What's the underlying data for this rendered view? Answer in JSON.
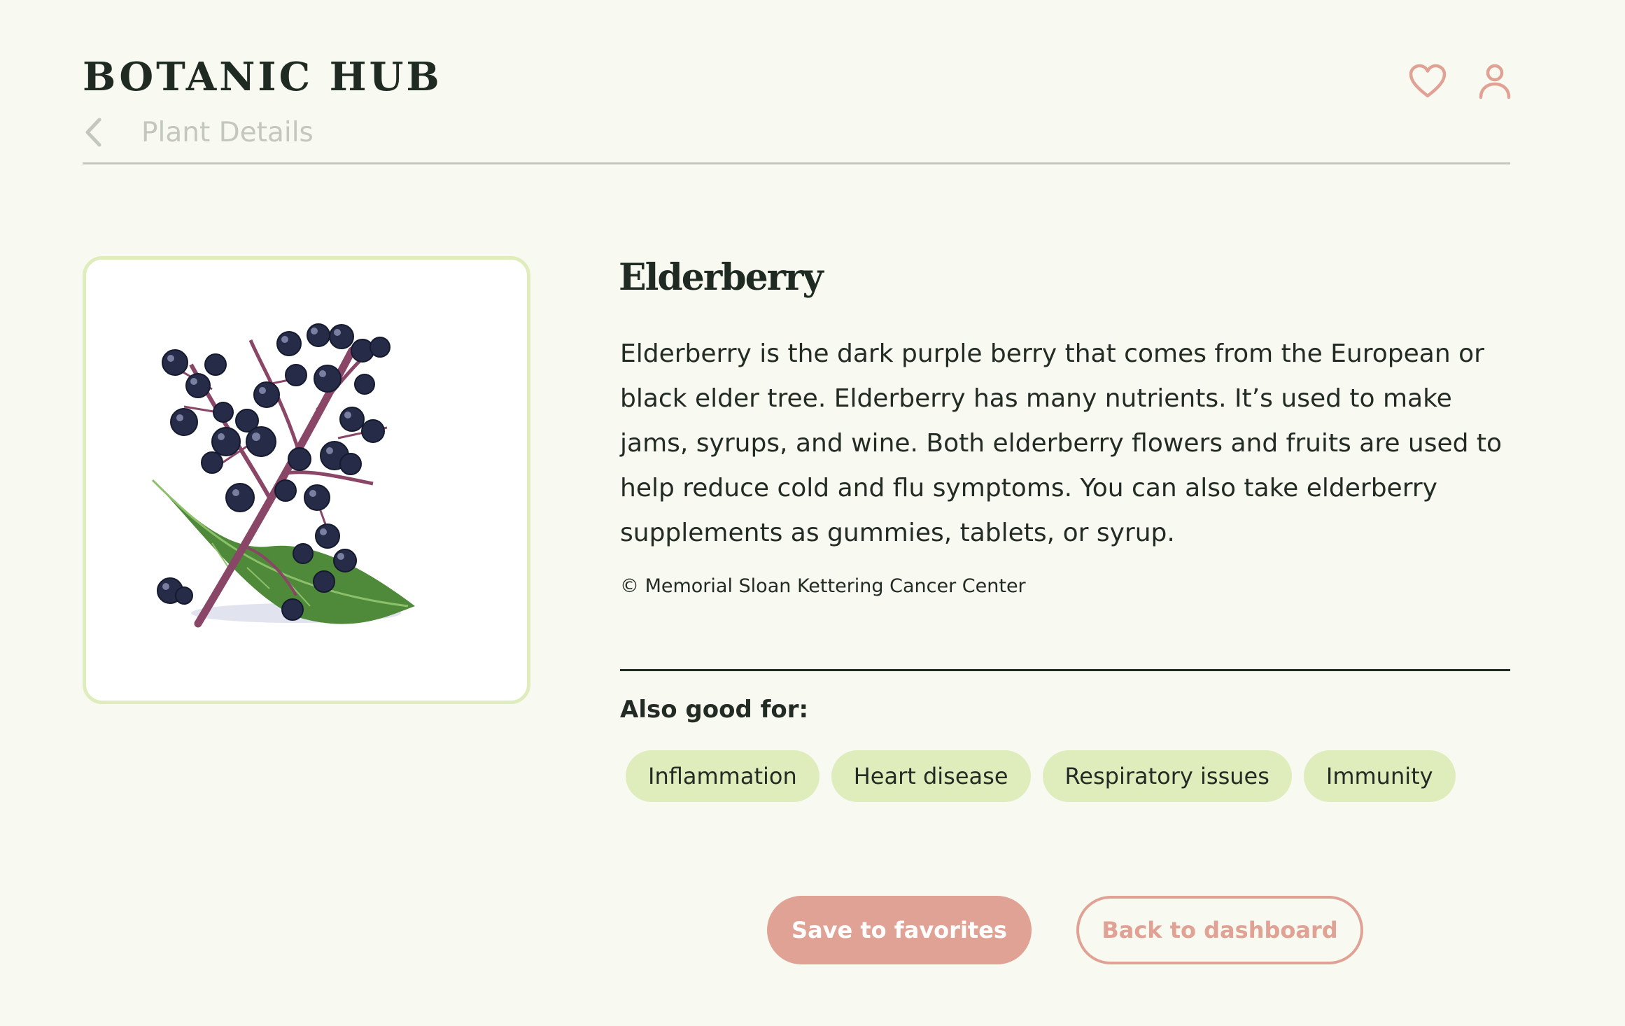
{
  "header": {
    "brand": "BOTANIC HUB",
    "subnav_title": "Plant Details",
    "icons": [
      "heart-icon",
      "user-icon",
      "chevron-left-icon"
    ]
  },
  "plant": {
    "name": "Elderberry",
    "description": "Elderberry is the dark purple berry that comes from the European or black elder tree. Elderberry has many nutrients. It’s used to make jams, syrups, and wine. Both elderberry flowers and fruits are used to help reduce cold and flu symptoms. You can also take elderberry supplements as gummies, tablets, or syrup.",
    "credit": "© Memorial Sloan Kettering Cancer Center"
  },
  "also_good_for": {
    "label": "Also good for:",
    "tags": [
      "Inflammation",
      "Heart disease",
      "Respiratory issues",
      "Immunity"
    ]
  },
  "actions": {
    "save_label": "Save to favorites",
    "back_label": "Back to dashboard"
  },
  "colors": {
    "background": "#f8f9f0",
    "accent": "#e0a294",
    "tag_bg": "#dfedbd",
    "text": "#1e2a22"
  }
}
